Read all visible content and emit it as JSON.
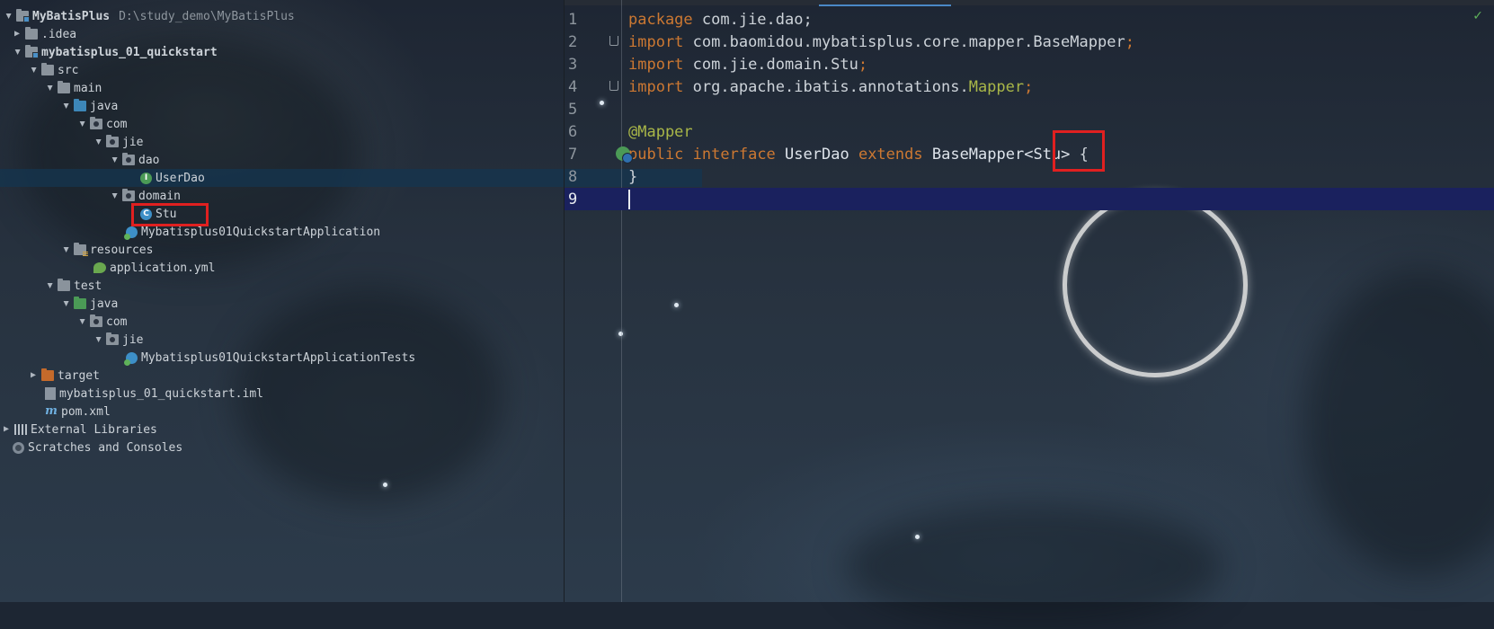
{
  "project_tree": {
    "root": {
      "label": "MyBatisPlus",
      "path": "D:\\study_demo\\MyBatisPlus"
    },
    "items": [
      {
        "label": ".idea"
      },
      {
        "label": "mybatisplus_01_quickstart"
      },
      {
        "label": "src"
      },
      {
        "label": "main"
      },
      {
        "label": "java"
      },
      {
        "label": "com"
      },
      {
        "label": "jie"
      },
      {
        "label": "dao"
      },
      {
        "label": "UserDao"
      },
      {
        "label": "domain"
      },
      {
        "label": "Stu"
      },
      {
        "label": "Mybatisplus01QuickstartApplication"
      },
      {
        "label": "resources"
      },
      {
        "label": "application.yml"
      },
      {
        "label": "test"
      },
      {
        "label": "java"
      },
      {
        "label": "com"
      },
      {
        "label": "jie"
      },
      {
        "label": "Mybatisplus01QuickstartApplicationTests"
      },
      {
        "label": "target"
      },
      {
        "label": "mybatisplus_01_quickstart.iml"
      },
      {
        "label": "pom.xml"
      },
      {
        "label": "External Libraries"
      },
      {
        "label": "Scratches and Consoles"
      }
    ]
  },
  "editor": {
    "line_numbers": [
      "1",
      "2",
      "3",
      "4",
      "5",
      "6",
      "7",
      "8",
      "9"
    ],
    "lines": {
      "l1": {
        "kw": "package",
        "rest": " com.jie.dao;"
      },
      "l2": {
        "kw": "import",
        "rest": " com.baomidou.mybatisplus.core.mapper.BaseMapper",
        "semi": ";"
      },
      "l3": {
        "kw": "import",
        "rest": " com.jie.domain.Stu",
        "semi": ";"
      },
      "l4": {
        "kw": "import",
        "rest": " org.apache.ibatis.annotations.",
        "ann": "Mapper",
        "semi": ";"
      },
      "l6": {
        "ann": "@Mapper"
      },
      "l7": {
        "kw1": "public",
        "kw2": "interface",
        "name": "UserDao",
        "kw3": "extends",
        "base": "BaseMapper",
        "generic": "<Stu>",
        "brace": " {"
      },
      "l8": {
        "brace": "}"
      }
    }
  },
  "colors": {
    "keyword": "#cc7832",
    "annotation": "#a9b748",
    "highlight_box": "#e02020",
    "current_line": "#1a215e"
  }
}
